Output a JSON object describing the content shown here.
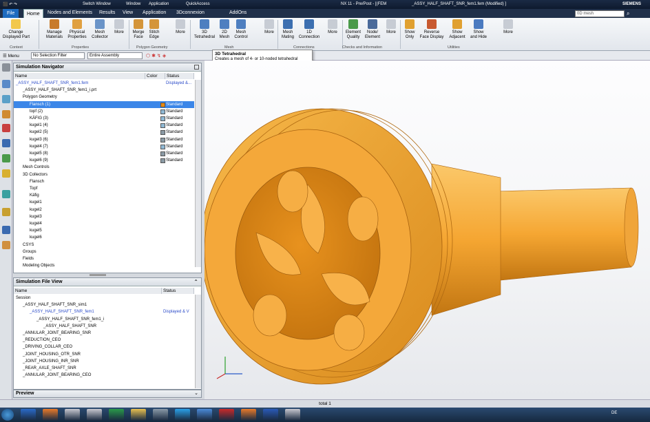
{
  "titlebar": {
    "app_title": "NX 11 - Pre/Post - [(FEM",
    "file_title": "_ASSY_HALF_SHAFT_SNR_fem1.fem (Modified) ]",
    "switch_window": "Switch Window",
    "window_menu": "Window",
    "application_label": "Application",
    "quickaccess": "QuickAccess",
    "brand": "SIEMENS"
  },
  "menubar": {
    "tabs": [
      "File",
      "Home",
      "Nodes and Elements",
      "Results",
      "View",
      "Application",
      "3Dconnexion",
      "AddOns"
    ],
    "active": "Home",
    "search_placeholder": "0D mesh"
  },
  "ribbon": {
    "buttons": [
      {
        "label": "Change\nDisplayed Part",
        "icon": "change-part-icon"
      },
      {
        "label": "Manage\nMaterials",
        "icon": "materials-icon"
      },
      {
        "label": "Physical\nProperties",
        "icon": "properties-icon"
      },
      {
        "label": "Mesh\nCollector",
        "icon": "mesh-collector-icon"
      },
      {
        "label": "More",
        "icon": "more-icon"
      },
      {
        "label": "Merge\nFace",
        "icon": "merge-face-icon"
      },
      {
        "label": "Stitch\nEdge",
        "icon": "stitch-edge-icon"
      },
      {
        "label": "More",
        "icon": "more-icon"
      },
      {
        "label": "3D\nTetrahedral",
        "icon": "tetrahedral-icon"
      },
      {
        "label": "2D\nMesh",
        "icon": "2d-mesh-icon"
      },
      {
        "label": "Mesh\nControl",
        "icon": "mesh-control-icon"
      },
      {
        "label": "More",
        "icon": "more-icon"
      },
      {
        "label": "Mesh\nMating",
        "icon": "mesh-mating-icon"
      },
      {
        "label": "1D\nConnection",
        "icon": "1d-connection-icon"
      },
      {
        "label": "More",
        "icon": "more-icon"
      },
      {
        "label": "Element\nQuality",
        "icon": "element-quality-icon"
      },
      {
        "label": "Node/\nElement",
        "icon": "node-element-icon"
      },
      {
        "label": "More",
        "icon": "more-icon"
      },
      {
        "label": "Show\nOnly",
        "icon": "show-only-icon"
      },
      {
        "label": "Reverse\nFace Display",
        "icon": "reverse-face-icon"
      },
      {
        "label": "Show\nAdjacent",
        "icon": "show-adjacent-icon"
      },
      {
        "label": "Show\nand Hide",
        "icon": "show-hide-icon"
      },
      {
        "label": "More",
        "icon": "more-icon"
      }
    ],
    "groups": [
      "Context",
      "Properties",
      "Polygon Geometry",
      "Mesh",
      "Connections",
      "Checks and Information",
      "Utilities"
    ]
  },
  "selbar": {
    "menu": "Menu",
    "filter": "No Selection Filter",
    "scope": "Entire Assembly"
  },
  "tooltip": {
    "title": "3D Tetrahedral",
    "text": "Creates a mesh of 4- or 10-noded tetrahedral elements on a solid body."
  },
  "sim_nav": {
    "title": "Simulation Navigator",
    "columns": [
      "Name",
      "Color",
      "Status"
    ],
    "rows": [
      {
        "name": "_ASSY_HALF_SHAFT_SNR_fem1.fem",
        "status": "Displayed &...",
        "indent": 0,
        "blue": true
      },
      {
        "name": "_ASSY_HALF_SHAFT_SNR_fem1_i.prt",
        "status": "",
        "indent": 1
      },
      {
        "name": "Polygon Geometry",
        "status": "",
        "indent": 1
      },
      {
        "name": "Flansch (1)",
        "status": "Standard",
        "indent": 2,
        "color": "#e8870f",
        "selected": true
      },
      {
        "name": "topf (2)",
        "status": "Standard",
        "indent": 2,
        "color": "#8fb8d4"
      },
      {
        "name": "KÄFIG (3)",
        "status": "Standard",
        "indent": 2,
        "color": "#8fb8d4"
      },
      {
        "name": "kugel1 (4)",
        "status": "Standard",
        "indent": 2,
        "color": "#8fb8d4"
      },
      {
        "name": "kugel2 (5)",
        "status": "Standard",
        "indent": 2,
        "color": "#8a9aa4"
      },
      {
        "name": "kugel3 (6)",
        "status": "Standard",
        "indent": 2,
        "color": "#8a9aa4"
      },
      {
        "name": "kugel4 (7)",
        "status": "Standard",
        "indent": 2,
        "color": "#8fb8d4"
      },
      {
        "name": "kugel5 (8)",
        "status": "Standard",
        "indent": 2,
        "color": "#8a9aa4"
      },
      {
        "name": "kugel6 (9)",
        "status": "Standard",
        "indent": 2,
        "color": "#8a9aa4"
      },
      {
        "name": "Mesh Controls",
        "status": "",
        "indent": 1
      },
      {
        "name": "3D Collectors",
        "status": "",
        "indent": 1
      },
      {
        "name": "Flansch",
        "status": "",
        "indent": 2
      },
      {
        "name": "Topf",
        "status": "",
        "indent": 2
      },
      {
        "name": "Käfig",
        "status": "",
        "indent": 2
      },
      {
        "name": "kugel1",
        "status": "",
        "indent": 2
      },
      {
        "name": "kugel2",
        "status": "",
        "indent": 2
      },
      {
        "name": "kugel3",
        "status": "",
        "indent": 2
      },
      {
        "name": "kugel4",
        "status": "",
        "indent": 2
      },
      {
        "name": "kugel5",
        "status": "",
        "indent": 2
      },
      {
        "name": "kugel6",
        "status": "",
        "indent": 2
      },
      {
        "name": "CSYS",
        "status": "",
        "indent": 1
      },
      {
        "name": "Groups",
        "status": "",
        "indent": 1
      },
      {
        "name": "Fields",
        "status": "",
        "indent": 1
      },
      {
        "name": "Modeling Objects",
        "status": "",
        "indent": 1
      }
    ]
  },
  "sim_file": {
    "title": "Simulation File View",
    "columns": [
      "Name",
      "Status"
    ],
    "rows": [
      {
        "name": "Session",
        "status": "",
        "indent": 0
      },
      {
        "name": "_ASSY_HALF_SHAFT_SNR_sim1",
        "status": "",
        "indent": 1
      },
      {
        "name": "_ASSY_HALF_SHAFT_SNR_fem1",
        "status": "Displayed & V",
        "indent": 2,
        "blue": true
      },
      {
        "name": "_ASSY_HALF_SHAFT_SNR_fem1_i",
        "status": "",
        "indent": 3
      },
      {
        "name": "_ASSY_HALF_SHAFT_SNR",
        "status": "",
        "indent": 4
      },
      {
        "name": "_ANNULAR_JOINT_BEARING_SNR",
        "status": "",
        "indent": 1
      },
      {
        "name": "_REDUCTION_CEO",
        "status": "",
        "indent": 1
      },
      {
        "name": "_DRIVING_COLLAR_CEO",
        "status": "",
        "indent": 1
      },
      {
        "name": "_JOINT_HOUSING_OTR_SNR",
        "status": "",
        "indent": 1
      },
      {
        "name": "_JOINT_HOUSING_INR_SNR",
        "status": "",
        "indent": 1
      },
      {
        "name": "_REAR_AXLE_SHAFT_SNR",
        "status": "",
        "indent": 1
      },
      {
        "name": "_ANNULAR_JOINT_BEARING_CEO",
        "status": "",
        "indent": 1
      }
    ]
  },
  "preview": {
    "title": "Preview"
  },
  "status": {
    "text": "total 1"
  },
  "taskbar": {
    "lang": "DE",
    "apps": [
      "outlook-icon",
      "firefox-icon",
      "app-icon",
      "app-icon",
      "excel-icon",
      "explorer-icon",
      "app-icon",
      "skype-icon",
      "app-icon",
      "acrobat-icon",
      "firefox-icon",
      "word-icon",
      "nx-icon"
    ]
  },
  "colors": {
    "model": "#f5a632",
    "accent": "#3b86e8"
  }
}
